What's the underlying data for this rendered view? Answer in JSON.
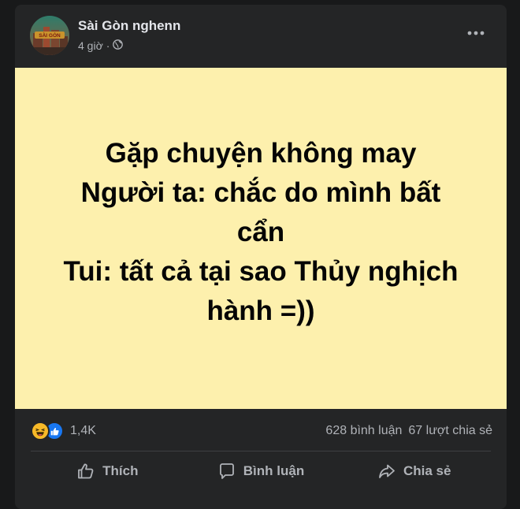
{
  "post": {
    "author": "Sài Gòn nghenn",
    "time": "4 giờ",
    "separator": "·",
    "avatar_text": "SÀI GÒN",
    "background_color": "#fdf0ad",
    "text_lines": [
      "Gặp chuyện không may",
      "Người ta: chắc do mình bất",
      "cẩn",
      "Tui: tất cả tại sao Thủy nghịch",
      "hành =))"
    ]
  },
  "stats": {
    "reaction_icons": [
      "haha-icon",
      "like-icon"
    ],
    "reaction_count": "1,4K",
    "comments": "628 bình luận",
    "shares": "67 lượt chia sẻ"
  },
  "actions": {
    "like_label": "Thích",
    "comment_label": "Bình luận",
    "share_label": "Chia sẻ"
  },
  "icons": {
    "privacy": "globe-icon",
    "more": "more-options-icon",
    "like": "thumbs-up-icon",
    "comment": "comment-bubble-icon",
    "share": "share-arrow-icon"
  },
  "colors": {
    "card": "#242526",
    "page": "#18191a",
    "text_primary": "#e4e6eb",
    "text_secondary": "#b0b3b8",
    "like_blue": "#1877f2",
    "haha_yellow": "#f7b928"
  }
}
